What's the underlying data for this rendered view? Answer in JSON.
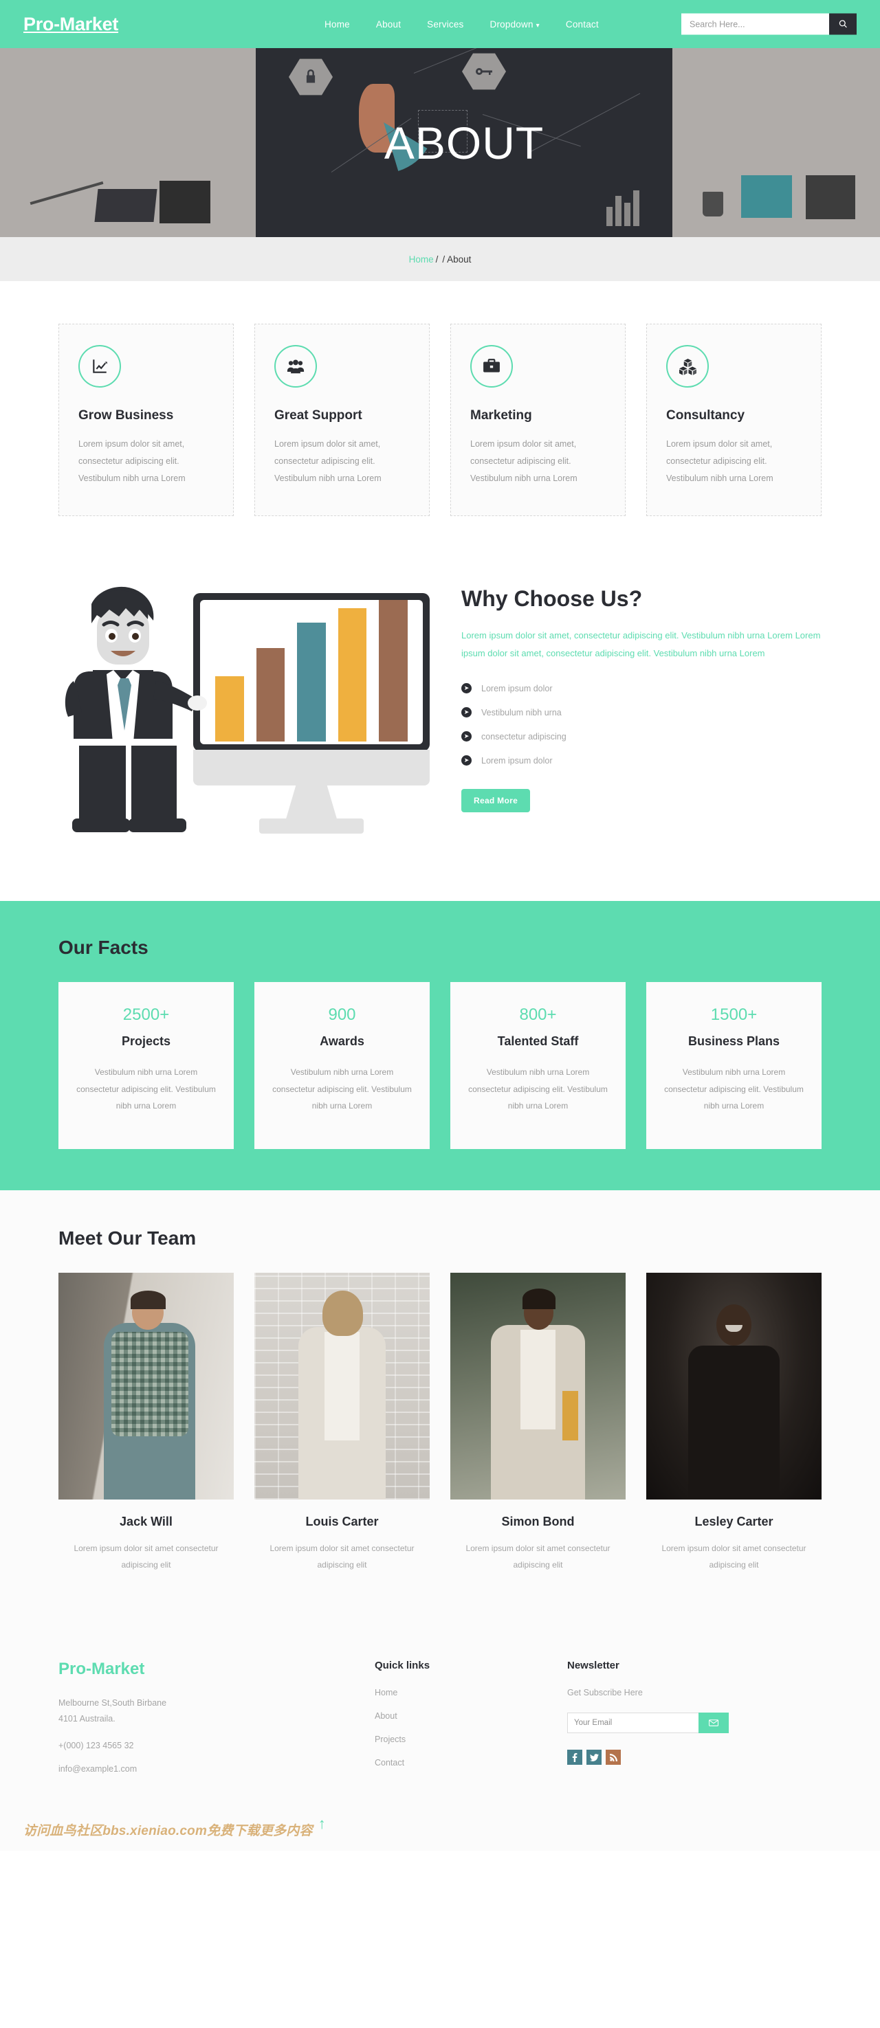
{
  "theme": {
    "accent": "#5ddcb0",
    "dark": "#2b2d33",
    "muted": "#a5a5a5",
    "panel": "#fbfbfb"
  },
  "header": {
    "brand": "Pro-Market",
    "nav": [
      {
        "label": "Home",
        "caret": ""
      },
      {
        "label": "About",
        "caret": ""
      },
      {
        "label": "Services",
        "caret": ""
      },
      {
        "label": "Dropdown",
        "caret": "⌄"
      },
      {
        "label": "Contact",
        "caret": ""
      }
    ],
    "search": {
      "placeholder": "Search Here...",
      "value": "",
      "icon": "search-icon"
    }
  },
  "hero": {
    "title": "ABOUT"
  },
  "breadcrumb": {
    "home": "Home",
    "sep1": "/",
    "sep2": "/",
    "current": "About"
  },
  "services": [
    {
      "icon": "chart-line-icon",
      "title": "Grow Business",
      "text": "Lorem ipsum dolor sit amet, consectetur adipiscing elit. Vestibulum nibh urna Lorem"
    },
    {
      "icon": "users-group-icon",
      "title": "Great Support",
      "text": "Lorem ipsum dolor sit amet, consectetur adipiscing elit. Vestibulum nibh urna Lorem"
    },
    {
      "icon": "briefcase-icon",
      "title": "Marketing",
      "text": "Lorem ipsum dolor sit amet, consectetur adipiscing elit. Vestibulum nibh urna Lorem"
    },
    {
      "icon": "cubes-icon",
      "title": "Consultancy",
      "text": "Lorem ipsum dolor sit amet, consectetur adipiscing elit. Vestibulum nibh urna Lorem"
    }
  ],
  "why": {
    "title": "Why Choose Us?",
    "lead": "Lorem ipsum dolor sit amet, consectetur adipiscing elit. Vestibulum nibh urna Lorem Lorem ipsum dolor sit amet, consectetur adipiscing elit. Vestibulum nibh urna Lorem",
    "list": [
      "Lorem ipsum dolor",
      "Vestibulum nibh urna",
      "consectetur adipiscing",
      "Lorem ipsum dolor"
    ],
    "button": "Read More",
    "illustration": {
      "alt": "businessman-presenting-bar-chart-illustration",
      "bars": [
        {
          "height_pct": 46,
          "color": "#efb03f"
        },
        {
          "height_pct": 66,
          "color": "#9b6b52"
        },
        {
          "height_pct": 84,
          "color": "#4f8e99"
        },
        {
          "height_pct": 94,
          "color": "#efb03f"
        },
        {
          "height_pct": 100,
          "color": "#9b6b52"
        }
      ]
    }
  },
  "facts": {
    "title": "Our Facts",
    "items": [
      {
        "number": "2500+",
        "label": "Projects",
        "text": "Vestibulum nibh urna Lorem consectetur adipiscing elit. Vestibulum nibh urna Lorem"
      },
      {
        "number": "900",
        "label": "Awards",
        "text": "Vestibulum nibh urna Lorem consectetur adipiscing elit. Vestibulum nibh urna Lorem"
      },
      {
        "number": "800+",
        "label": "Talented Staff",
        "text": "Vestibulum nibh urna Lorem consectetur adipiscing elit. Vestibulum nibh urna Lorem"
      },
      {
        "number": "1500+",
        "label": "Business Plans",
        "text": "Vestibulum nibh urna Lorem consectetur adipiscing elit. Vestibulum nibh urna Lorem"
      }
    ]
  },
  "team": {
    "title": "Meet Our Team",
    "members": [
      {
        "name": "Jack Will",
        "text": "Lorem ipsum dolor sit amet consectetur adipiscing elit",
        "photo": "man-in-plaid-shirt-against-brick-wall"
      },
      {
        "name": "Louis Carter",
        "text": "Lorem ipsum dolor sit amet consectetur adipiscing elit",
        "photo": "woman-in-white-coat-against-white-brick-wall"
      },
      {
        "name": "Simon Bond",
        "text": "Lorem ipsum dolor sit amet consectetur adipiscing elit",
        "photo": "man-in-light-blazer-outdoors"
      },
      {
        "name": "Lesley Carter",
        "text": "Lorem ipsum dolor sit amet consectetur adipiscing elit",
        "photo": "man-smiling-on-dark-background"
      }
    ]
  },
  "footer": {
    "brand": "Pro-Market",
    "address_line1": "Melbourne St,South Birbane",
    "address_line2": "4101 Austraila.",
    "phone": "+(000) 123 4565 32",
    "email": "info@example1.com",
    "quick_links_title": "Quick links",
    "quick_links": [
      "Home",
      "About",
      "Projects",
      "Contact"
    ],
    "newsletter_title": "Newsletter",
    "newsletter_subtitle": "Get Subscribe Here",
    "email_placeholder": "Your Email",
    "email_value": "",
    "send_icon": "envelope-icon",
    "socials": [
      {
        "name": "facebook-icon",
        "glyph": "f",
        "color": "#46808c"
      },
      {
        "name": "twitter-icon",
        "glyph": "t",
        "color": "#46808c"
      },
      {
        "name": "rss-icon",
        "glyph": "r",
        "color": "#b4734c"
      }
    ]
  },
  "watermark": {
    "text": "访问血鸟社区bbs.xieniao.com免费下载更多内容",
    "scroll_top_icon": "arrow-up-icon"
  }
}
